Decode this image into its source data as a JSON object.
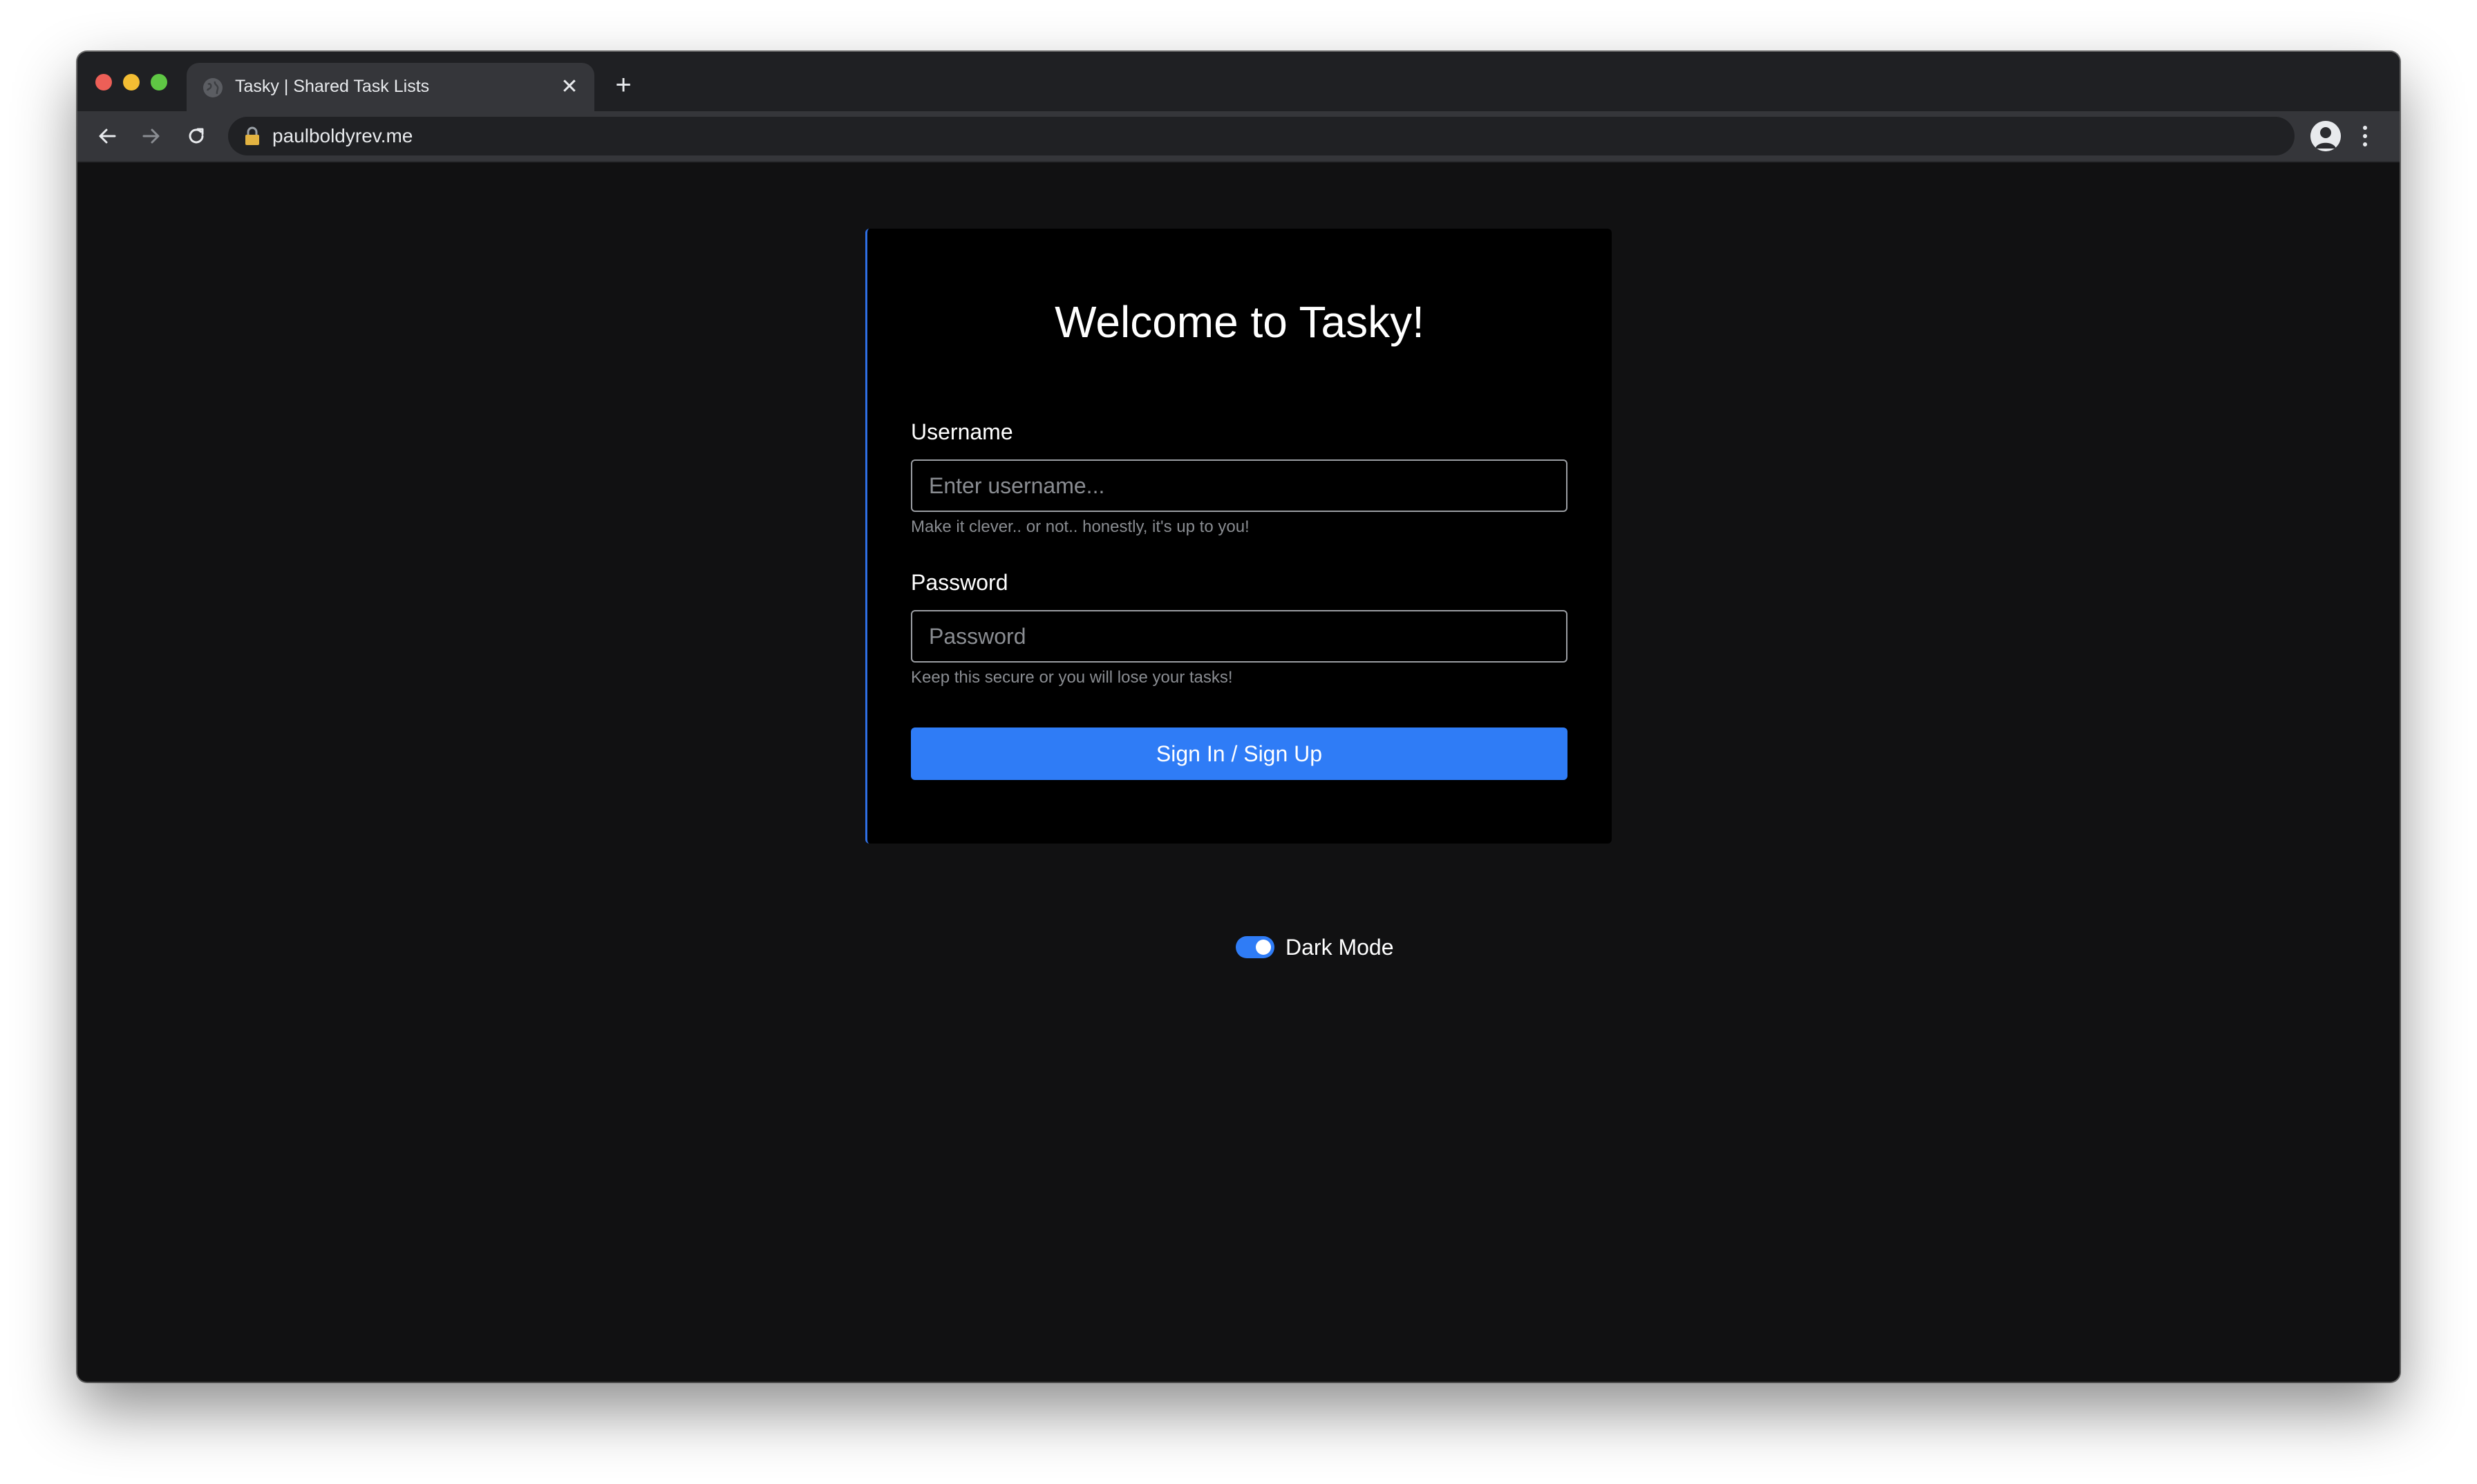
{
  "browser": {
    "tab": {
      "title": "Tasky | Shared Task Lists",
      "favicon_icon": "globe-icon",
      "close_glyph": "✕"
    },
    "new_tab_glyph": "+",
    "address_bar": {
      "url": "paulboldyrev.me",
      "security_icon": "lock-icon"
    },
    "controls": {
      "back_icon": "arrow-left-icon",
      "forward_icon": "arrow-right-icon",
      "reload_icon": "reload-icon",
      "profile_icon": "avatar-icon",
      "menu_icon": "kebab-menu-icon"
    }
  },
  "login": {
    "title": "Welcome to Tasky!",
    "username": {
      "label": "Username",
      "value": "",
      "placeholder": "Enter username...",
      "help": "Make it clever.. or not.. honestly, it's up to you!"
    },
    "password": {
      "label": "Password",
      "value": "",
      "placeholder": "Password",
      "help": "Keep this secure or you will lose your tasks!"
    },
    "submit_label": "Sign In / Sign Up"
  },
  "theme_toggle": {
    "label": "Dark Mode",
    "checked": true
  },
  "colors": {
    "accent": "#2f7cf6",
    "page_background": "#111112",
    "card_background": "#000000",
    "card_accent_border": "#2f6fe5",
    "muted_text": "#8a8d92"
  }
}
